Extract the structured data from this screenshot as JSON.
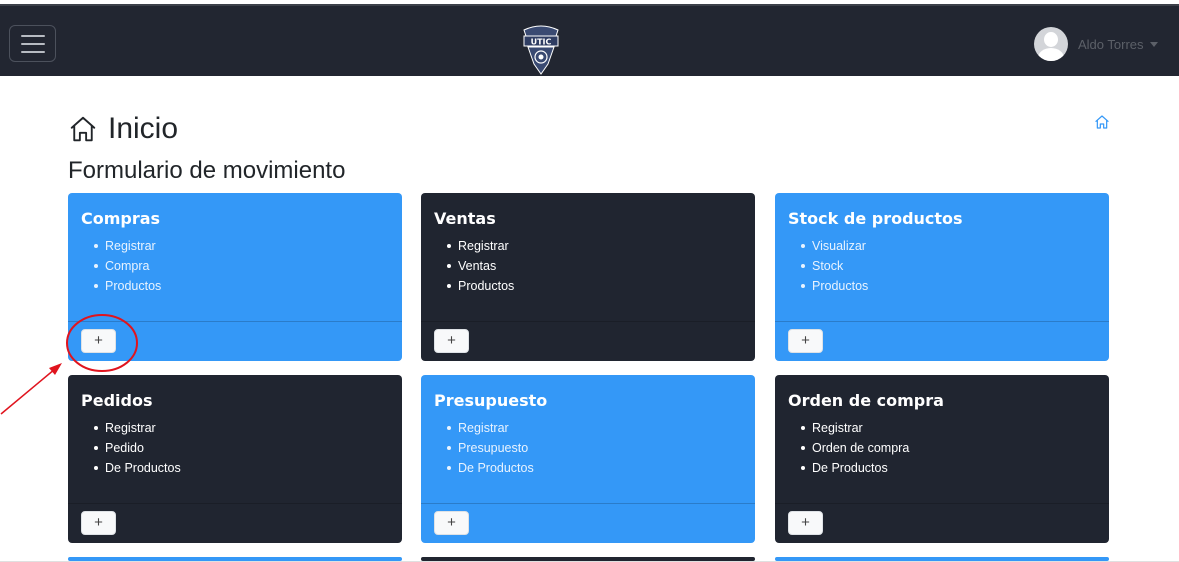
{
  "navbar": {
    "user_name": "Aldo Torres",
    "logo_text": "UTIC",
    "icons": {
      "menu": "hamburger-icon",
      "avatar": "user-avatar",
      "dropdown": "caret-down-icon"
    }
  },
  "page": {
    "title": "Inicio",
    "title_icon": "house-icon",
    "breadcrumb_icon": "house-icon",
    "subtitle": "Formulario de movimiento"
  },
  "cards": [
    {
      "title": "Compras",
      "items": [
        "Registrar",
        "Compra",
        "Productos"
      ],
      "color": "#3498f7",
      "button": "+"
    },
    {
      "title": "Ventas",
      "items": [
        "Registrar",
        "Ventas",
        "Productos"
      ],
      "color": "#202530",
      "button": "+"
    },
    {
      "title": "Stock de productos",
      "items": [
        "Visualizar",
        "Stock",
        "Productos"
      ],
      "color": "#3498f7",
      "button": "+"
    },
    {
      "title": "Pedidos",
      "items": [
        "Registrar",
        "Pedido",
        "De Productos"
      ],
      "color": "#202530",
      "button": "+"
    },
    {
      "title": "Presupuesto",
      "items": [
        "Registrar",
        "Presupuesto",
        "De Productos"
      ],
      "color": "#3498f7",
      "button": "+"
    },
    {
      "title": "Orden de compra",
      "items": [
        "Registrar",
        "Orden de compra",
        "De Productos"
      ],
      "color": "#202530",
      "button": "+"
    }
  ],
  "colors": {
    "navbar": "#222631",
    "card_blue": "#3498f7",
    "card_dark": "#202530",
    "annotation": "#e0141e"
  }
}
